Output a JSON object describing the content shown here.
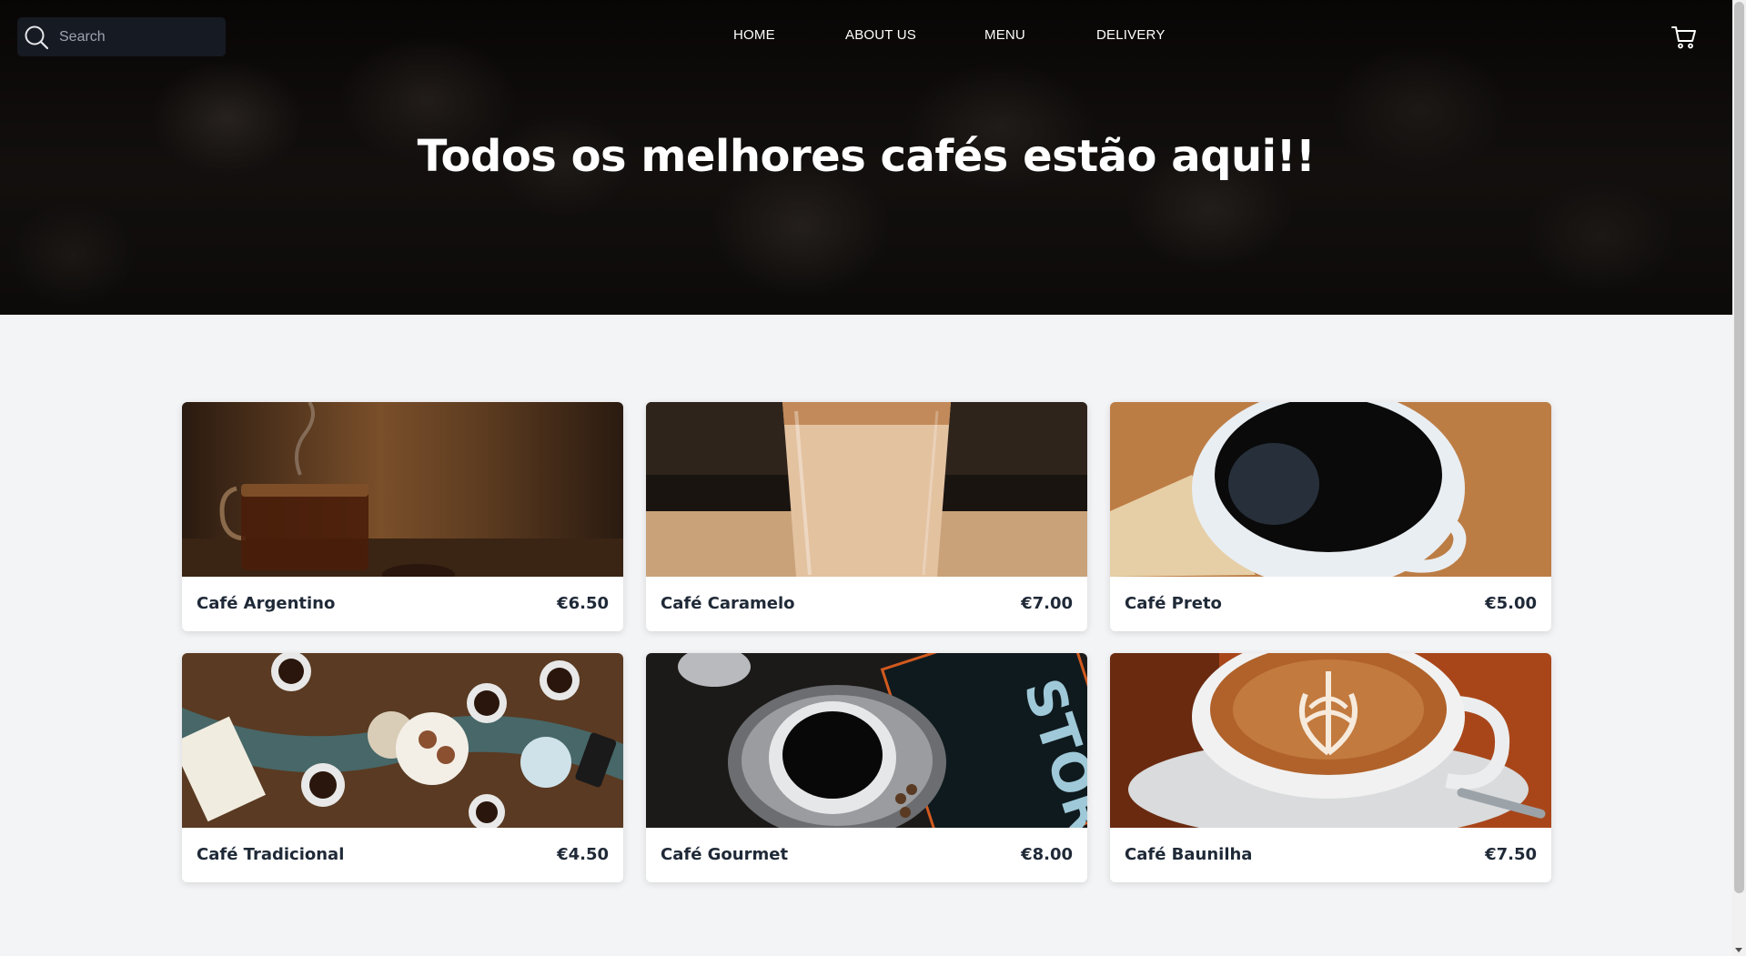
{
  "search": {
    "placeholder": "Search",
    "icon": "search-icon"
  },
  "nav": {
    "items": [
      {
        "label": "HOME"
      },
      {
        "label": "ABOUT US"
      },
      {
        "label": "MENU"
      },
      {
        "label": "DELIVERY"
      }
    ],
    "cart_icon": "cart-icon"
  },
  "hero": {
    "title": "Todos os melhores cafés estão aqui!!"
  },
  "products": [
    {
      "name": "Café Argentino",
      "price": "€6.50"
    },
    {
      "name": "Café Caramelo",
      "price": "€7.00"
    },
    {
      "name": "Café Preto",
      "price": "€5.00"
    },
    {
      "name": "Café Tradicional",
      "price": "€4.50"
    },
    {
      "name": "Café Gourmet",
      "price": "€8.00"
    },
    {
      "name": "Café Baunilha",
      "price": "€7.50"
    }
  ],
  "colors": {
    "page_bg": "#f3f4f6",
    "header_bg": "#0d0a09",
    "search_bg": "#161a22",
    "card_bg": "#ffffff",
    "text_dark": "#1f2937"
  }
}
